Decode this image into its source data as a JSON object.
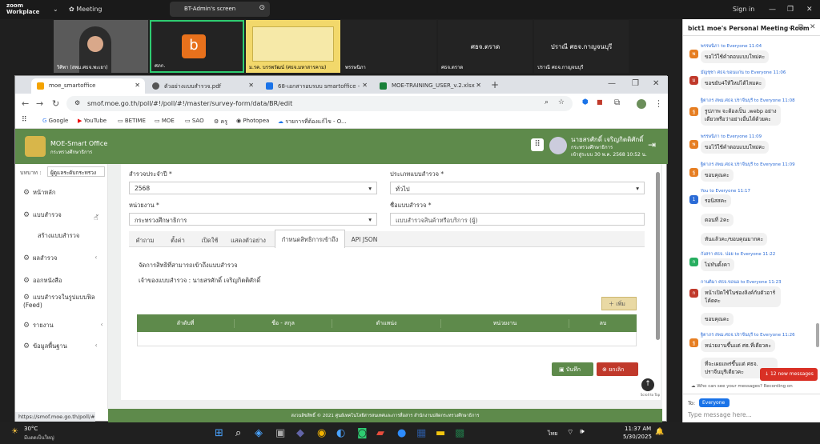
{
  "zoom": {
    "logo_line1": "zoom",
    "logo_line2": "Workplace",
    "meeting_label": "Meeting",
    "share_label": "BT-Admin's screen",
    "sign_in": "Sign in"
  },
  "participants": [
    {
      "name": "วิศิพา (สพม.ศธจ.พะเยา)"
    },
    {
      "name": "ศภก.",
      "initial": "b"
    },
    {
      "name": "ม.รค. บรรพวัฒน์ (ศธจ.มหาสารคาม)"
    },
    {
      "name": "พรรษนิภา"
    },
    {
      "name": "ศธจ.ตราด",
      "label": "ศธจ.ตราด"
    },
    {
      "name": "ปราณี ศธจ.กาญจนบุรี",
      "label": "ปราณี ศธจ.กาญจนบุรี"
    }
  ],
  "browser": {
    "tabs": [
      {
        "label": "moe_smartoffice",
        "color": "#f4a300"
      },
      {
        "label": "ตัวอย่างแบบสำรวจ.pdf",
        "color": "#555"
      },
      {
        "label": "68-เอกสารอบรมบ smartoffice -",
        "color": "#1a73e8"
      },
      {
        "label": "MOE-TRAINING_USER_v.2.xlsx",
        "color": "#188038"
      }
    ],
    "url": "smof.moe.go.th/poll/#!/poll/#!/master/survey-form/data/BR/edit",
    "bookmarks": [
      "Google",
      "YouTube",
      "BETIME",
      "MOE",
      "SAO",
      "ครู",
      "Photopea",
      "รายการที่ต้องแก้ไข - O..."
    ],
    "status_url": "https://smof.moe.go.th/poll/#"
  },
  "app": {
    "brand": "MOE-Smart Office",
    "brand_sub": "กระทรวงศึกษาธิการ",
    "user_name": "นายสรศักดิ์ เจริญกิตติศักดิ์",
    "user_org": "กระทรวงศึกษาธิการ",
    "user_login": "เข้าสู่ระบบ 30 พ.ค. 2568 10:52 น.",
    "role_label": "บทบาท :",
    "role_value": "ผู้ดูแลระดับกระทรวง",
    "menu": [
      {
        "label": "หน้าหลัก"
      },
      {
        "label": "แบบสำรวจ"
      },
      {
        "label": "สร้างแบบสำรวจ"
      },
      {
        "label": "ผลสำรวจ"
      },
      {
        "label": "ออกหนังสือ"
      },
      {
        "label": "แบบสำรวจในรูปแบบฟิล (Feed)"
      },
      {
        "label": "รายงาน"
      },
      {
        "label": "ข้อมูลพื้นฐาน"
      }
    ],
    "form": {
      "year_label": "สำรวจประจำปี *",
      "year_value": "2568",
      "type_label": "ประเภทแบบสำรวจ *",
      "type_value": "ทั่วไป",
      "agency_label": "หน่วยงาน *",
      "agency_value": "กระทรวงศึกษาธิการ",
      "name_label": "ชื่อแบบสำรวจ *",
      "name_value": "แบบสำรวจสินค้าหรือบริการ (ผู้)"
    },
    "form_tabs": [
      "คำถาม",
      "ตั้งค่า",
      "เปิดใช้",
      "แสดงตัวอย่าง",
      "กำหนดสิทธิการเข้าถึง",
      "API JSON"
    ],
    "access": {
      "title": "จัดการสิทธิที่สามารถเข้าถึงแบบสำรวจ",
      "owner": "เจ้าของแบบสำรวจ : นายสรศักดิ์ เจริญกิตติศักดิ์",
      "add_label": "เพิ่ม",
      "columns": [
        "ลำดับที่",
        "ชื่อ - สกุล",
        "ตำแหน่ง",
        "หน่วยงาน",
        "ลบ"
      ]
    },
    "save_label": "บันทึก",
    "cancel_label": "ยกเลิก",
    "scroll_top": "Scroll to Top",
    "footer": "สงวนลิขสิทธิ์ © 2021 ศูนย์เทคโนโลยีสารสนเทศและการสื่อสาร สำนักงานปลัดกระทรวงศึกษาธิการ"
  },
  "chat": {
    "title": "bict1 moe's Personal Meeting Room",
    "messages": [
      {
        "from": "พรรษนิภา to Everyone 11:04",
        "text": "ขอไว้ใช้คำตอบแบบใหม่คะ",
        "color": "#e67e22",
        "initial": "พ"
      },
      {
        "from": "มัญชุชา ศธจ.ขอนแก่น to Everyone 11:06",
        "text": "ขอขยับ4ให้ใหม่ได้ไหมคะ",
        "color": "#c0392b",
        "initial": "ม"
      },
      {
        "from": "ฐิตาภร สพม.ศธจ.ปราจีนบุรี to Everyone 11:08",
        "text": "รูปภาพ จะต้องเป็น .webp อย่างเดียวหรือว่าอย่างอื่นได้ด้วยคะ",
        "color": "#e67e22",
        "initial": "ฐ"
      },
      {
        "from": "พรรษนิภา to Everyone 11:09",
        "text": "ขอไว้ใช้คำตอบแบบใหม่คะ",
        "color": "#e67e22",
        "initial": "พ"
      },
      {
        "from": "ฐิตาภร สพม.ศธจ.ปราจีนบุรี to Everyone 11:09",
        "text": "ขอบคุณคะ",
        "color": "#e67e22",
        "initial": "ฐ"
      },
      {
        "from": "You to Everyone 11:17",
        "text": "รอนิสสคะ",
        "color": "#2b6bd6",
        "initial": "1"
      },
      {
        "from": "",
        "text": "ตอนที่ 2คะ",
        "color": "",
        "initial": ""
      },
      {
        "from": "",
        "text": "ทันแล้วคะ/ขอบคุณมากคะ",
        "color": "",
        "initial": ""
      },
      {
        "from": "กังสรา ศธจ. ปอย to Everyone 11:22",
        "text": "ไม่ทันตั้งคา",
        "color": "#27ae60",
        "initial": "ก"
      },
      {
        "from": "กานติมา ศธจ.ขอนอ to Everyone 11:23",
        "text": "หน้าเปิดใช้ในช่องลิงค์กับตัวอาร์โค้ดคะ",
        "color": "#c0392b",
        "initial": "ก"
      },
      {
        "from": "",
        "text": "ขอบคุณคะ",
        "color": "",
        "initial": ""
      },
      {
        "from": "ฐิตาภร สพม.ศธจ.ปราจีนบุรี to Everyone 11:26",
        "text": "หน่วยงานขึ้นแต่ ศธ.ที่เดียวคะ",
        "color": "#e67e22",
        "initial": "ฐ"
      },
      {
        "from": "",
        "text": "ที่จะเผยแพร่ขึ้นแต่ ศธจ. ปราจีนบุรีเดียวคะ",
        "color": "",
        "initial": ""
      }
    ],
    "new_messages": "12 new messages",
    "who_can_see": "Who can see your messages? Recording on",
    "to_label": "To:",
    "to_value": "Everyone",
    "placeholder": "Type message here..."
  },
  "taskbar": {
    "weather_temp": "30°C",
    "weather_desc": "มีแดดเป็นใหญ่",
    "lang": "ไทย",
    "time": "11:37 AM",
    "date": "5/30/2025"
  }
}
